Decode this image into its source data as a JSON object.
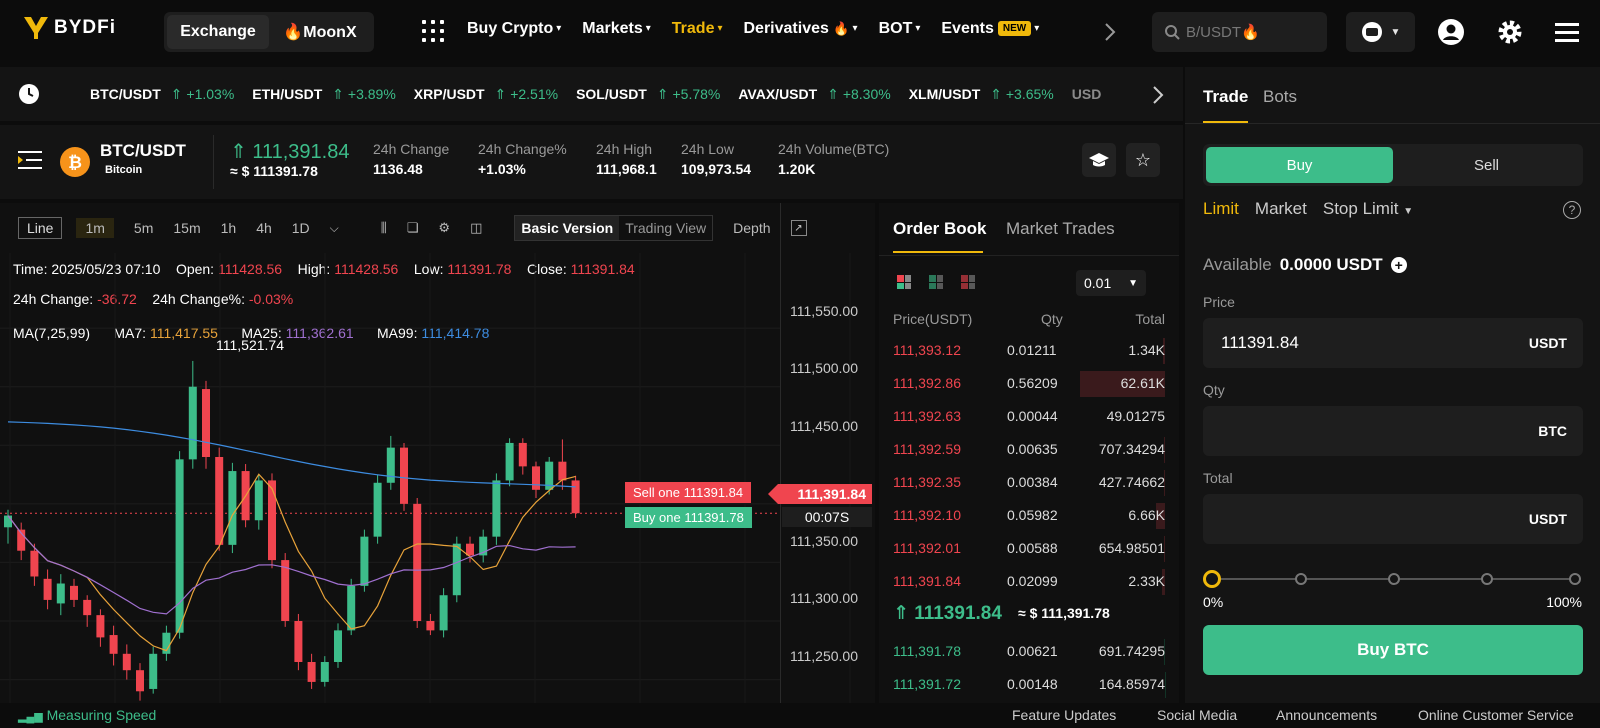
{
  "brand": {
    "name": "BYDFi"
  },
  "nav": {
    "seg": [
      "Exchange",
      "🔥MoonX"
    ],
    "menu": [
      {
        "label": "Buy Crypto",
        "caret": "▾"
      },
      {
        "label": "Markets",
        "caret": "▾"
      },
      {
        "label": "Trade",
        "caret": "▾"
      },
      {
        "label": "Derivatives",
        "caret": "▾"
      },
      {
        "label": "BOT",
        "caret": "▾"
      },
      {
        "label": "Events",
        "caret": "▾"
      }
    ],
    "fire": "🔥",
    "new_badge": "NEW",
    "search_placeholder": "B/USDT🔥"
  },
  "ticker": [
    {
      "pair": "BTC/USDT",
      "chg": "+1.03%"
    },
    {
      "pair": "ETH/USDT",
      "chg": "+3.89%"
    },
    {
      "pair": "XRP/USDT",
      "chg": "+2.51%"
    },
    {
      "pair": "SOL/USDT",
      "chg": "+5.78%"
    },
    {
      "pair": "AVAX/USDT",
      "chg": "+8.30%"
    },
    {
      "pair": "XLM/USDT",
      "chg": "+3.65%"
    },
    {
      "pair": "USD",
      "chg": ""
    }
  ],
  "pair": {
    "symbol": "BTC/USDT",
    "name": "Bitcoin",
    "price": "111,391.84",
    "approx": "≈ $ 111391.78",
    "stats": [
      {
        "l": "24h Change",
        "v": "1136.48",
        "c": "up"
      },
      {
        "l": "24h Change%",
        "v": "+1.03%",
        "c": "up"
      },
      {
        "l": "24h High",
        "v": "111,968.1",
        "c": ""
      },
      {
        "l": "24h Low",
        "v": "109,973.54",
        "c": ""
      },
      {
        "l": "24h Volume(BTC)",
        "v": "1.20K",
        "c": ""
      }
    ]
  },
  "chart": {
    "line": "Line",
    "tfs": [
      "1m",
      "5m",
      "15m",
      "1h",
      "4h",
      "1D"
    ],
    "basic": "Basic Version",
    "tv": "Trading View",
    "depth": "Depth",
    "info1": {
      "time_l": "Time: ",
      "time": "2025/05/23 07:10",
      "open_l": "Open: ",
      "open": "111428.56",
      "high_l": "High: ",
      "high": "111428.56",
      "low_l": "Low: ",
      "low": "111391.78",
      "close_l": "Close: ",
      "close": "111391.84"
    },
    "info2": {
      "ch_l": "24h Change: ",
      "ch": "-36.72",
      "chp_l": "24h Change%: ",
      "chp": "-0.03%"
    },
    "ma": {
      "title": "MA(7,25,99)",
      "ma7_l": "MA7: ",
      "ma7": "111,417.55",
      "ma25_l": "MA25: ",
      "ma25": "111,362.61",
      "ma99_l": "MA99: ",
      "ma99": "111,414.78"
    },
    "yticks": [
      "111,550.00",
      "111,500.00",
      "111,450.00",
      "111,350.00",
      "111,300.00",
      "111,250.00"
    ],
    "peak": "111,521.74",
    "sell_tag": "Sell one 111391.84",
    "buy_tag": "Buy one 111391.78",
    "cur": "111,391.84",
    "countdown": "00:07S"
  },
  "chart_data": {
    "type": "candlestick",
    "ylim": [
      111230,
      111580
    ],
    "candles": [
      [
        111380,
        111390,
        111366,
        111395
      ],
      [
        111378,
        111360,
        111352,
        111384
      ],
      [
        111360,
        111338,
        111330,
        111366
      ],
      [
        111336,
        111318,
        111310,
        111344
      ],
      [
        111315,
        111332,
        111305,
        111340
      ],
      [
        111330,
        111318,
        111312,
        111336
      ],
      [
        111318,
        111305,
        111295,
        111322
      ],
      [
        111305,
        111286,
        111278,
        111310
      ],
      [
        111288,
        111272,
        111262,
        111296
      ],
      [
        111272,
        111258,
        111250,
        111280
      ],
      [
        111258,
        111240,
        111232,
        111264
      ],
      [
        111242,
        111272,
        111238,
        111278
      ],
      [
        111272,
        111290,
        111266,
        111296
      ],
      [
        111290,
        111438,
        111285,
        111445
      ],
      [
        111438,
        111500,
        111430,
        111522
      ],
      [
        111498,
        111440,
        111430,
        111505
      ],
      [
        111440,
        111365,
        111360,
        111448
      ],
      [
        111365,
        111428,
        111358,
        111435
      ],
      [
        111428,
        111386,
        111380,
        111434
      ],
      [
        111386,
        111420,
        111378,
        111425
      ],
      [
        111420,
        111352,
        111345,
        111426
      ],
      [
        111352,
        111300,
        111295,
        111358
      ],
      [
        111300,
        111265,
        111258,
        111306
      ],
      [
        111265,
        111248,
        111242,
        111272
      ],
      [
        111248,
        111265,
        111244,
        111270
      ],
      [
        111265,
        111292,
        111260,
        111298
      ],
      [
        111292,
        111330,
        111288,
        111336
      ],
      [
        111330,
        111372,
        111325,
        111378
      ],
      [
        111372,
        111418,
        111366,
        111425
      ],
      [
        111418,
        111448,
        111412,
        111458
      ],
      [
        111448,
        111400,
        111394,
        111452
      ],
      [
        111400,
        111300,
        111294,
        111405
      ],
      [
        111300,
        111292,
        111288,
        111306
      ],
      [
        111292,
        111322,
        111286,
        111328
      ],
      [
        111322,
        111366,
        111316,
        111372
      ],
      [
        111366,
        111356,
        111350,
        111372
      ],
      [
        111356,
        111372,
        111350,
        111378
      ],
      [
        111372,
        111420,
        111365,
        111426
      ],
      [
        111420,
        111452,
        111415,
        111456
      ],
      [
        111452,
        111432,
        111425,
        111456
      ],
      [
        111432,
        111412,
        111405,
        111436
      ],
      [
        111412,
        111436,
        111408,
        111440
      ],
      [
        111436,
        111420,
        111412,
        111455
      ],
      [
        111420,
        111392,
        111388,
        111424
      ]
    ]
  },
  "orderbook": {
    "tab1": "Order Book",
    "tab2": "Market Trades",
    "prec": "0.01",
    "h_price": "Price(USDT)",
    "h_qty": "Qty",
    "h_total": "Total",
    "asks": [
      [
        "111,393.12",
        "0.01211",
        "1.34K"
      ],
      [
        "111,392.86",
        "0.56209",
        "62.61K"
      ],
      [
        "111,392.63",
        "0.00044",
        "49.01275"
      ],
      [
        "111,392.59",
        "0.00635",
        "707.34294"
      ],
      [
        "111,392.35",
        "0.00384",
        "427.74662"
      ],
      [
        "111,392.10",
        "0.05982",
        "6.66K"
      ],
      [
        "111,392.01",
        "0.00588",
        "654.98501"
      ],
      [
        "111,391.84",
        "0.02099",
        "2.33K"
      ]
    ],
    "mid": "111391.84",
    "mid_usd": "≈ $ 111,391.78",
    "bids": [
      [
        "111,391.78",
        "0.00621",
        "691.74295"
      ],
      [
        "111,391.72",
        "0.00148",
        "164.85974"
      ]
    ]
  },
  "trade": {
    "tabs": [
      "Trade",
      "Bots"
    ],
    "buy": "Buy",
    "sell": "Sell",
    "types": [
      "Limit",
      "Market",
      "Stop Limit"
    ],
    "avail_l": "Available",
    "avail": "0.0000 USDT",
    "price_l": "Price",
    "price": "111391.84",
    "unit_usdt": "USDT",
    "qty_l": "Qty",
    "unit_btc": "BTC",
    "total_l": "Total",
    "p0": "0%",
    "p100": "100%",
    "cta": "Buy BTC"
  },
  "footer": {
    "speed": "Measuring Speed",
    "links": [
      "Feature Updates",
      "Social Media",
      "Announcements",
      "Online Customer Service"
    ]
  }
}
